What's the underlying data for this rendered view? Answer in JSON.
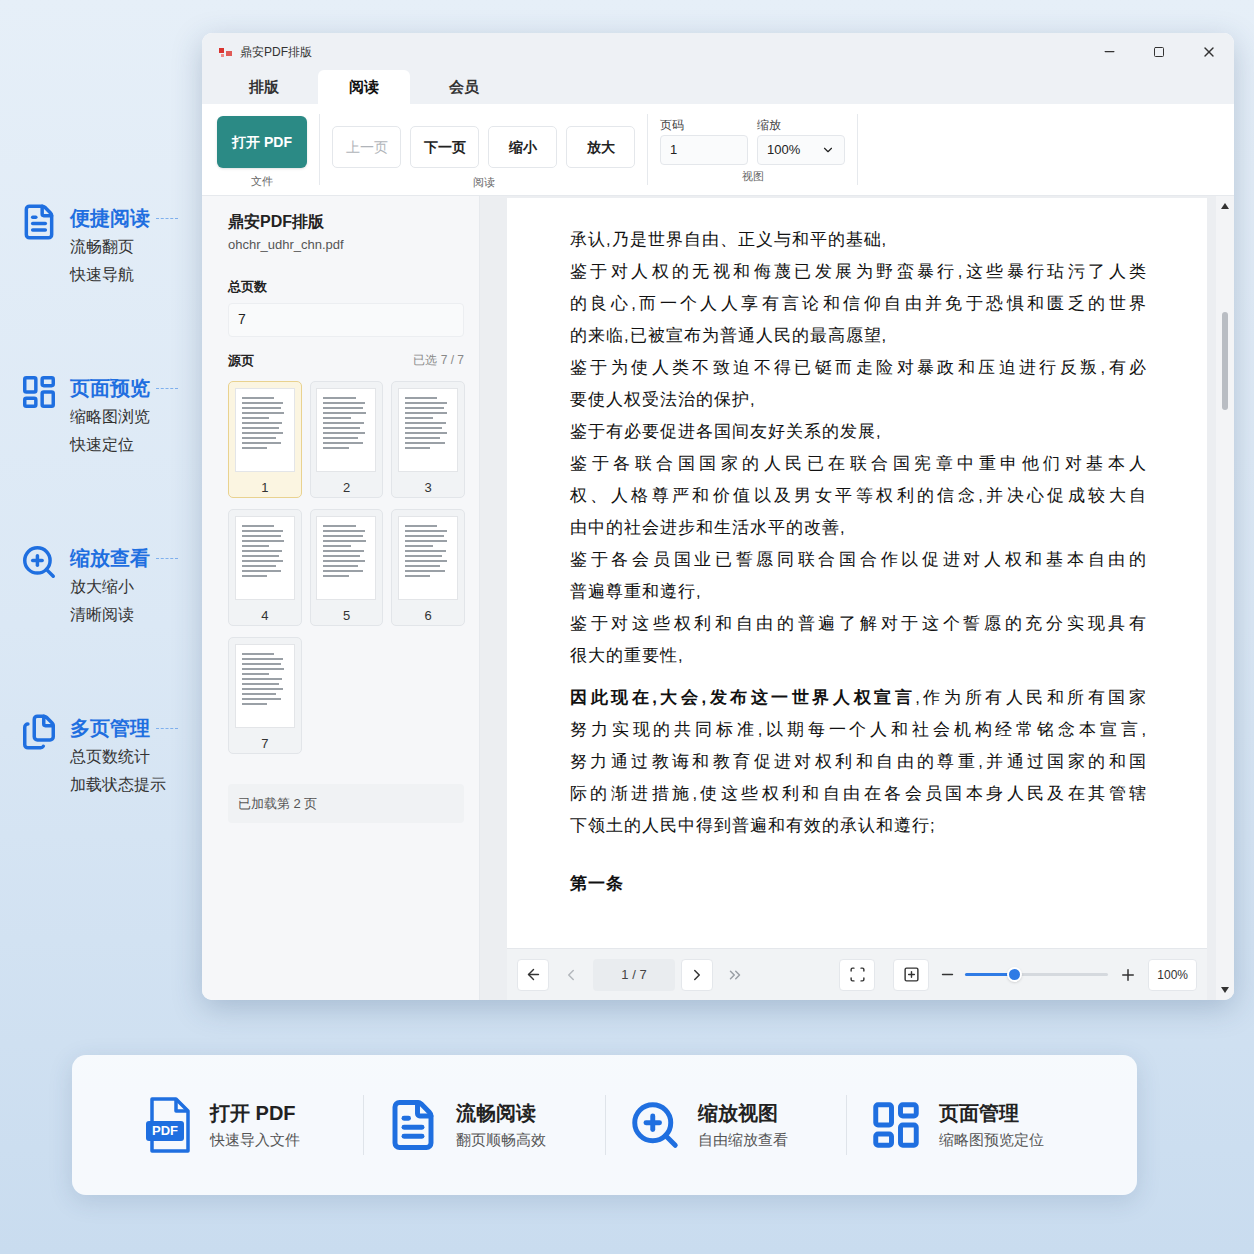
{
  "window": {
    "title": "鼎安PDF排版"
  },
  "tabs": [
    {
      "label": "排版",
      "selected": false
    },
    {
      "label": "阅读",
      "selected": true
    },
    {
      "label": "会员",
      "selected": false
    }
  ],
  "toolbar": {
    "file_group": {
      "label": "文件",
      "button": "打开 PDF"
    },
    "read_group": {
      "label": "阅读",
      "buttons": [
        {
          "label": "上一页",
          "disabled": true
        },
        {
          "label": "下一页",
          "disabled": false
        },
        {
          "label": "缩小",
          "disabled": false
        },
        {
          "label": "放大",
          "disabled": false
        }
      ]
    },
    "view_group": {
      "label": "视图",
      "page_label": "页码",
      "page_value": "1",
      "zoom_label": "缩放",
      "zoom_value": "100%"
    }
  },
  "sidebar": {
    "title": "鼎安PDF排版",
    "file": "ohchr_udhr_chn.pdf",
    "total_label": "总页数",
    "total_value": "7",
    "source_label": "源页",
    "selected_count": "已选 7 / 7",
    "thumbnails": [
      {
        "label": "1",
        "selected": true
      },
      {
        "label": "2",
        "selected": false
      },
      {
        "label": "3",
        "selected": false
      },
      {
        "label": "4",
        "selected": false
      },
      {
        "label": "5",
        "selected": false
      },
      {
        "label": "6",
        "selected": false
      },
      {
        "label": "7",
        "selected": false
      }
    ],
    "status": "已加载第 2 页"
  },
  "document": {
    "paragraphs": [
      {
        "lead": "",
        "lines": [
          "承认,乃是世界自由、正义与和平的基础,"
        ]
      },
      {
        "lead": "",
        "lines": [
          "鉴于对人权的无视和侮蔑已发展为野蛮暴行,这些暴行玷污了人类",
          "的良心,而一个人人享有言论和信仰自由并免于恐惧和匮乏的世界",
          "的来临,已被宣布为普通人民的最高愿望,"
        ]
      },
      {
        "lead": "",
        "lines": [
          "鉴于为使人类不致迫不得已铤而走险对暴政和压迫进行反叛,有必",
          "要使人权受法治的保护,"
        ]
      },
      {
        "lead": "",
        "lines": [
          "鉴于有必要促进各国间友好关系的发展,"
        ]
      },
      {
        "lead": "",
        "lines": [
          "鉴于各联合国国家的人民已在联合国宪章中重申他们对基本人",
          "权、人格尊严和价值以及男女平等权利的信念,并决心促成较大自",
          "由中的社会进步和生活水平的改善,"
        ]
      },
      {
        "lead": "",
        "lines": [
          "鉴于各会员国业已誓愿同联合国合作以促进对人权和基本自由的",
          "普遍尊重和遵行,"
        ]
      },
      {
        "lead": "",
        "lines": [
          "鉴于对这些权利和自由的普遍了解对于这个誓愿的充分实现具有",
          "很大的重要性,"
        ]
      },
      {
        "lead": "因此现在,大会,发布这一世界人权宣言",
        "lines": [
          ",作为所有人民和所有国家",
          "努力实现的共同标准,以期每一个人和社会机构经常铭念本宣言,",
          "努力通过教诲和教育促进对权利和自由的尊重,并通过国家的和国",
          "际的渐进措施,使这些权利和自由在各会员国本身人民及在其管辖",
          "下领土的人民中得到普遍和有效的承认和遵行;"
        ]
      }
    ],
    "heading": "第一条"
  },
  "viewer_bar": {
    "nav": [
      {
        "kind": "back",
        "disabled": false
      },
      {
        "kind": "prev",
        "disabled": true
      },
      {
        "kind": "next",
        "disabled": false
      },
      {
        "kind": "last",
        "disabled": true
      }
    ],
    "page": "1 / 7",
    "zoom_level": 0.34,
    "zoom": "100%"
  },
  "callouts": [
    {
      "kind": "doc",
      "title": "便捷阅读",
      "lines": [
        "流畅翻页",
        "快速导航"
      ]
    },
    {
      "kind": "grid",
      "title": "页面预览",
      "lines": [
        "缩略图浏览",
        "快速定位"
      ]
    },
    {
      "kind": "zoom",
      "title": "缩放查看",
      "lines": [
        "放大缩小",
        "清晰阅读"
      ]
    },
    {
      "kind": "pages",
      "title": "多页管理",
      "lines": [
        "总页数统计",
        "加载状态提示"
      ]
    }
  ],
  "features": [
    {
      "kind": "pdf",
      "icon_text": "PDF",
      "title": "打开 PDF",
      "subtitle": "快速导入文件"
    },
    {
      "kind": "doc",
      "icon_text": "",
      "title": "流畅阅读",
      "subtitle": "翻页顺畅高效"
    },
    {
      "kind": "zoom",
      "icon_text": "",
      "title": "缩放视图",
      "subtitle": "自由缩放查看"
    },
    {
      "kind": "grid",
      "icon_text": "",
      "title": "页面管理",
      "subtitle": "缩略图预览定位"
    }
  ]
}
